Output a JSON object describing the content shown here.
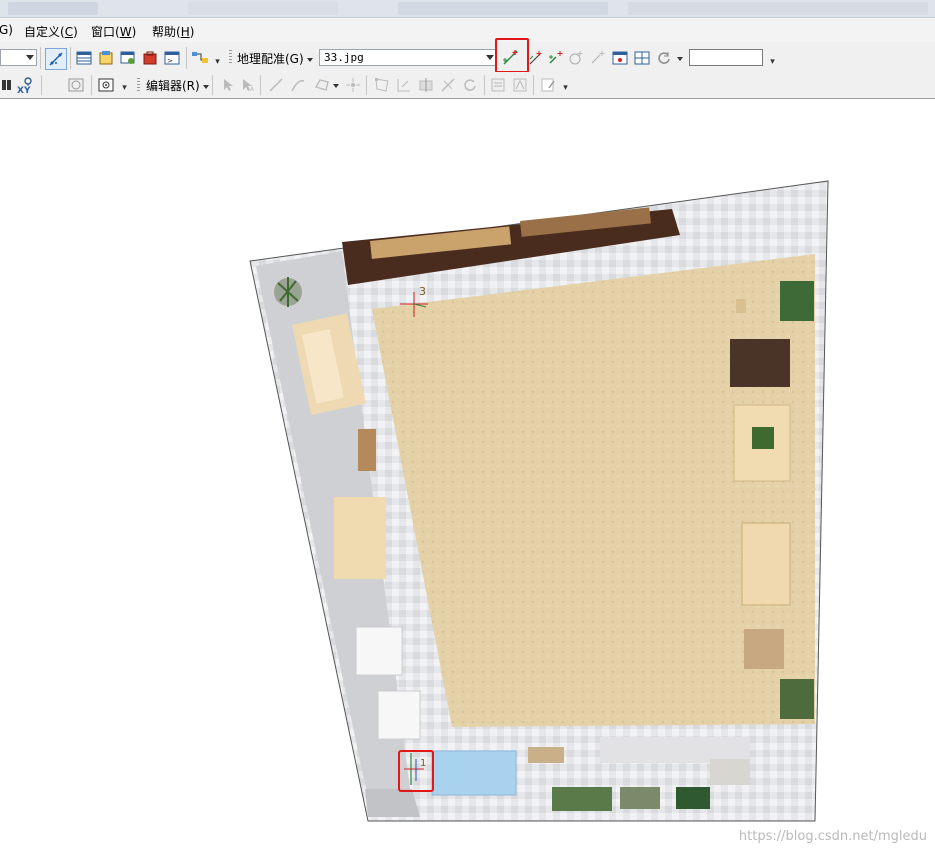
{
  "menubar": {
    "items": [
      {
        "label": "G)",
        "accel": ""
      },
      {
        "label": "自定义(",
        "accel": "C",
        "suffix": ")"
      },
      {
        "label": "窗口(",
        "accel": "W",
        "suffix": ")"
      },
      {
        "label": "帮助(",
        "accel": "H",
        "suffix": ")"
      }
    ]
  },
  "georef_toolbar": {
    "menu_label": "地理配准(G)",
    "layer_value": "33.jpg",
    "scale_input_value": ""
  },
  "editor_toolbar": {
    "menu_label": "编辑器(R)",
    "xy_label": "XY"
  },
  "map": {
    "control_points": [
      {
        "label": "3"
      },
      {
        "label": "1"
      }
    ]
  },
  "watermark": "https://blog.csdn.net/mgledu",
  "colors": {
    "highlight": "#e21818",
    "toolbar_bg": "#f0f0f0",
    "carpet": "#e3cfa6"
  }
}
